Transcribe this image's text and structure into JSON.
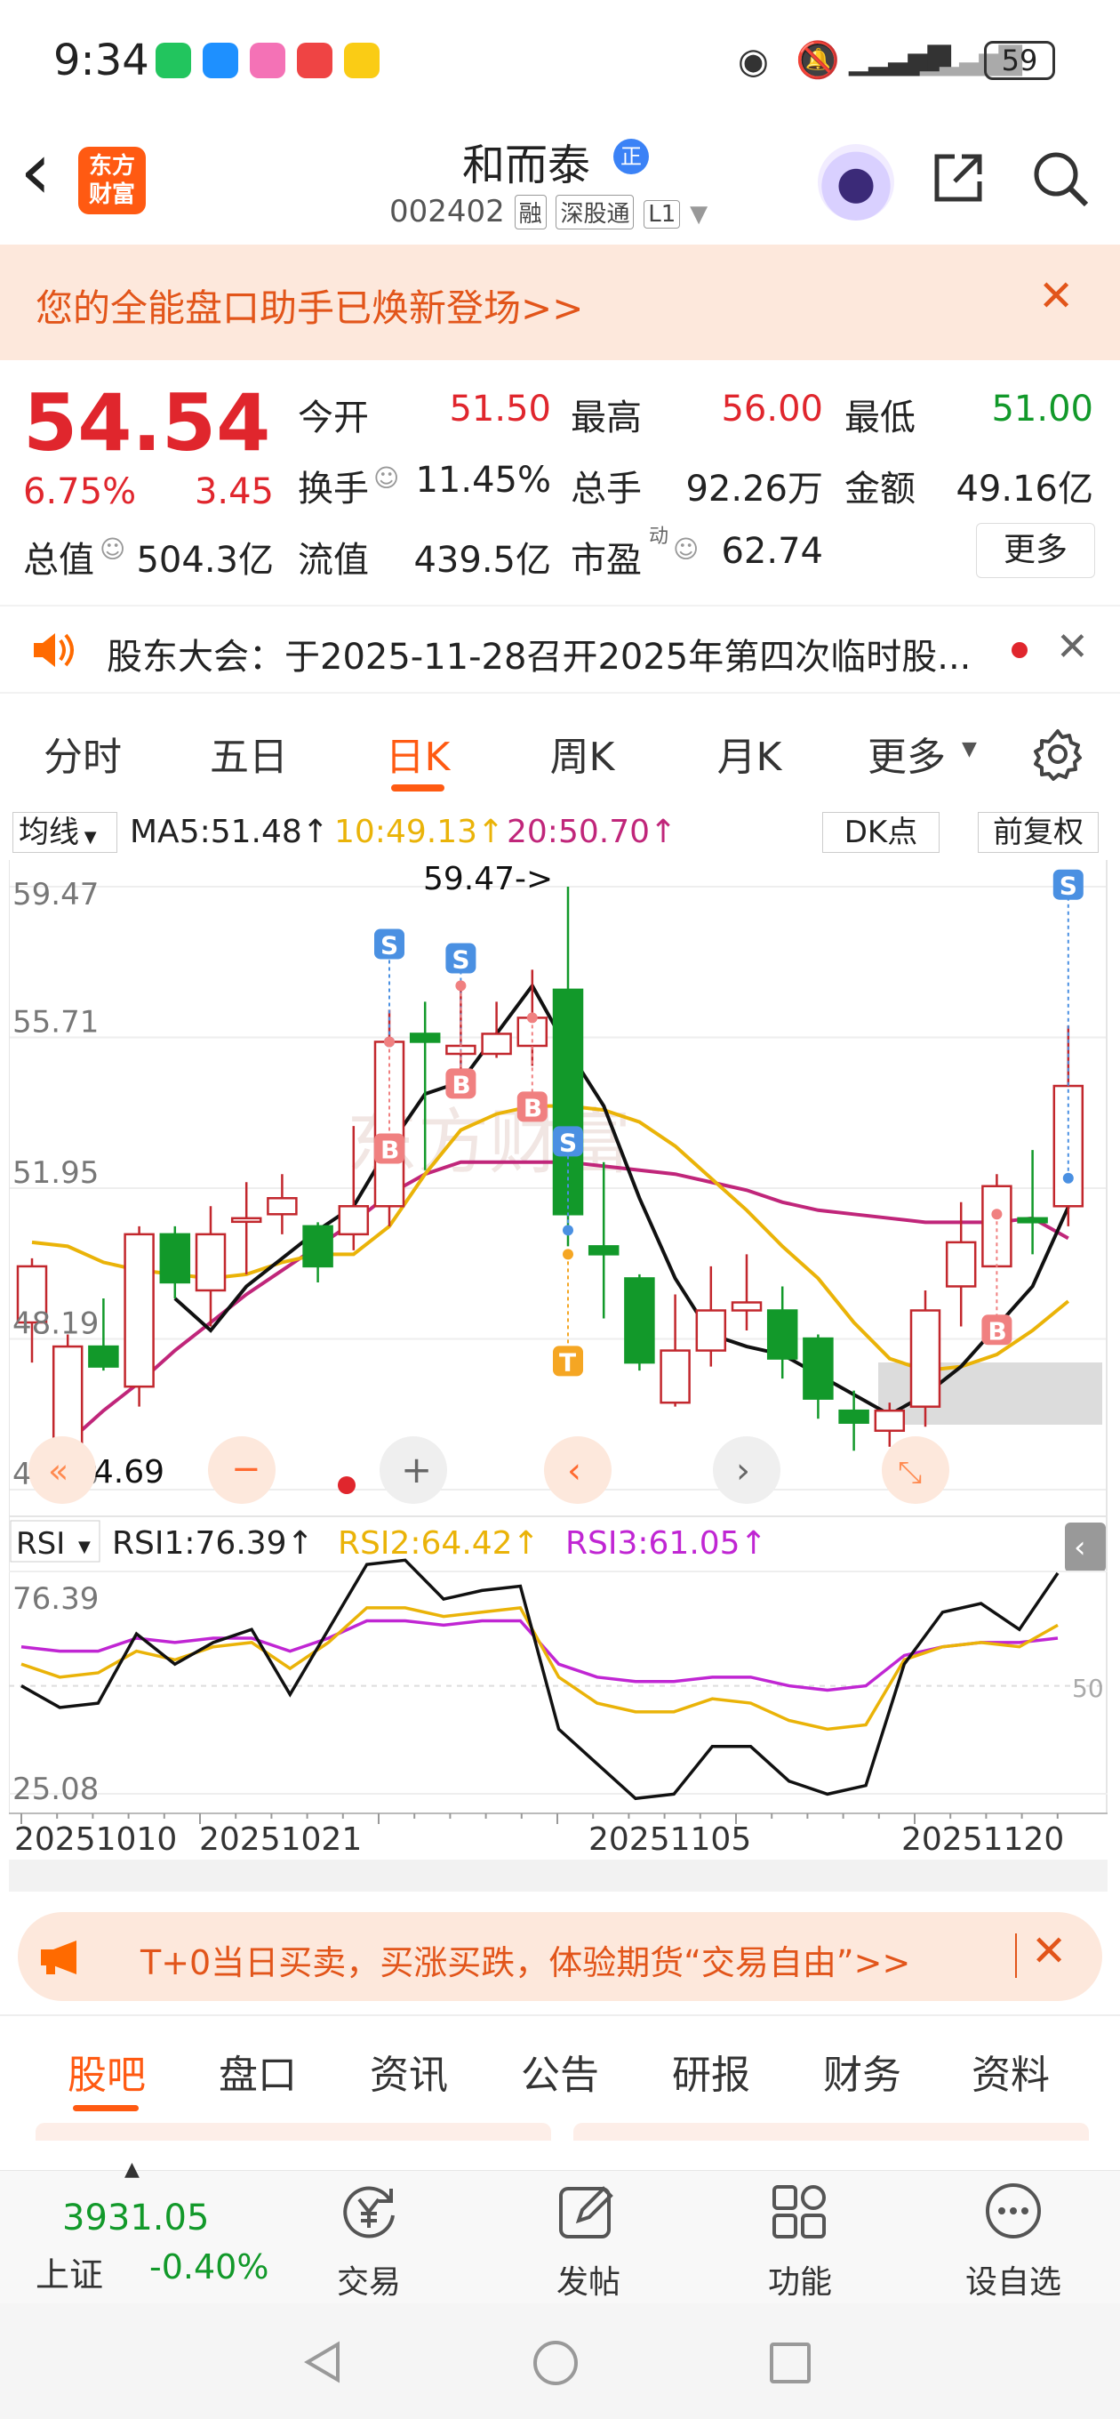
{
  "status": {
    "time": "9:34",
    "battery": "59"
  },
  "header": {
    "back": "‹",
    "logo_line1": "东方",
    "logo_line2": "财富",
    "title": "和而泰",
    "title_badge": "正",
    "code": "002402",
    "tags": [
      "融",
      "深股通",
      "L1"
    ]
  },
  "banner": {
    "text": "您的全能盘口助手已焕新登场>>"
  },
  "quote": {
    "price": "54.54",
    "pct": "6.75%",
    "chg": "3.45",
    "fields": [
      {
        "label": "今开",
        "value": "51.50",
        "color": "red"
      },
      {
        "label": "最高",
        "value": "56.00",
        "color": "red"
      },
      {
        "label": "最低",
        "value": "51.00",
        "color": "green"
      },
      {
        "label": "换手",
        "value": "11.45%",
        "color": "dark"
      },
      {
        "label": "总手",
        "value": "92.26万",
        "color": "dark"
      },
      {
        "label": "金额",
        "value": "49.16亿",
        "color": "dark"
      },
      {
        "label": "总值",
        "value": "504.3亿",
        "color": "dark"
      },
      {
        "label": "流值",
        "value": "439.5亿",
        "color": "dark"
      },
      {
        "label": "市盈",
        "value": "62.74",
        "color": "dark"
      }
    ],
    "dyn_sup": "动",
    "more": "更多"
  },
  "notice": {
    "text": "股东大会：于2025-11-28召开2025年第四次临时股..."
  },
  "tabs": [
    {
      "label": "分时",
      "active": false
    },
    {
      "label": "五日",
      "active": false
    },
    {
      "label": "日K",
      "active": true
    },
    {
      "label": "周K",
      "active": false
    },
    {
      "label": "月K",
      "active": false
    },
    {
      "label": "更多",
      "active": false
    }
  ],
  "ma": {
    "selector": "均线",
    "ma5": "MA5:51.48↑",
    "ma10": "10:49.13↑",
    "ma20": "20:50.70↑",
    "dk": "DK点",
    "fq": "前复权"
  },
  "chart_data": {
    "type": "candlestick",
    "y_ticks": [
      "59.47",
      "55.71",
      "51.95",
      "48.19",
      "44.43"
    ],
    "ylim": [
      44.43,
      59.47
    ],
    "high_label": "59.47->",
    "low_label": "44.69",
    "x_labels": [
      "20251010",
      "20251021",
      "20251105",
      "20251120"
    ],
    "candles": [
      {
        "o": 48.6,
        "c": 50.0,
        "h": 50.2,
        "l": 47.6
      },
      {
        "o": 44.7,
        "c": 48.0,
        "h": 48.3,
        "l": 44.69
      },
      {
        "o": 48.0,
        "c": 47.5,
        "h": 49.2,
        "l": 47.4
      },
      {
        "o": 47.0,
        "c": 50.8,
        "h": 51.0,
        "l": 46.5
      },
      {
        "o": 50.8,
        "c": 49.6,
        "h": 51.0,
        "l": 49.2
      },
      {
        "o": 49.4,
        "c": 50.8,
        "h": 51.5,
        "l": 48.5
      },
      {
        "o": 51.2,
        "c": 51.2,
        "h": 52.1,
        "l": 49.8
      },
      {
        "o": 51.3,
        "c": 51.7,
        "h": 52.3,
        "l": 50.8
      },
      {
        "o": 51.0,
        "c": 50.0,
        "h": 51.1,
        "l": 49.6
      },
      {
        "o": 50.8,
        "c": 51.5,
        "h": 53.5,
        "l": 50.4
      },
      {
        "o": 51.5,
        "c": 55.6,
        "h": 56.4,
        "l": 51.0
      },
      {
        "o": 55.8,
        "c": 55.6,
        "h": 56.6,
        "l": 52.4
      },
      {
        "o": 55.3,
        "c": 55.5,
        "h": 56.9,
        "l": 54.4
      },
      {
        "o": 55.3,
        "c": 55.8,
        "h": 56.6,
        "l": 55.2
      },
      {
        "o": 55.5,
        "c": 56.2,
        "h": 57.4,
        "l": 55.0
      },
      {
        "o": 56.9,
        "c": 51.3,
        "h": 59.47,
        "l": 50.5
      },
      {
        "o": 50.5,
        "c": 50.3,
        "h": 52.6,
        "l": 48.7
      },
      {
        "o": 49.7,
        "c": 47.6,
        "h": 49.8,
        "l": 47.4
      },
      {
        "o": 46.6,
        "c": 47.9,
        "h": 49.3,
        "l": 46.5
      },
      {
        "o": 47.9,
        "c": 48.9,
        "h": 50.0,
        "l": 47.5
      },
      {
        "o": 48.9,
        "c": 49.1,
        "h": 50.3,
        "l": 48.4
      },
      {
        "o": 48.9,
        "c": 47.7,
        "h": 49.5,
        "l": 47.2
      },
      {
        "o": 48.2,
        "c": 46.7,
        "h": 48.3,
        "l": 46.2
      },
      {
        "o": 46.4,
        "c": 46.1,
        "h": 46.9,
        "l": 45.4
      },
      {
        "o": 45.9,
        "c": 46.4,
        "h": 46.6,
        "l": 45.5
      },
      {
        "o": 46.5,
        "c": 48.9,
        "h": 49.4,
        "l": 46.0
      },
      {
        "o": 49.5,
        "c": 50.6,
        "h": 51.6,
        "l": 48.5
      },
      {
        "o": 50.0,
        "c": 52.0,
        "h": 52.3,
        "l": 50.0
      },
      {
        "o": 51.2,
        "c": 51.1,
        "h": 52.9,
        "l": 50.3
      },
      {
        "o": 51.5,
        "c": 54.5,
        "h": 56.0,
        "l": 51.0
      }
    ],
    "ma5": [
      null,
      null,
      null,
      null,
      49.2,
      48.4,
      49.5,
      50.2,
      50.9,
      51.5,
      53.0,
      54.3,
      54.6,
      55.8,
      57.0,
      55.4,
      54.0,
      51.7,
      49.7,
      48.3,
      48.0,
      47.8,
      47.3,
      46.8,
      46.3,
      46.8,
      47.5,
      48.5,
      49.5,
      51.48
    ],
    "ma10": [
      50.6,
      50.5,
      50.1,
      49.9,
      49.8,
      49.7,
      49.8,
      50.1,
      50.3,
      50.3,
      51.0,
      52.3,
      53.4,
      53.8,
      54.0,
      54.0,
      53.9,
      53.6,
      53.0,
      52.2,
      51.4,
      50.5,
      49.7,
      48.6,
      47.7,
      47.4,
      47.5,
      47.8,
      48.4,
      49.13
    ],
    "ma20": [
      44.8,
      45.6,
      46.4,
      47.1,
      47.9,
      48.6,
      49.3,
      49.9,
      50.5,
      51.1,
      51.8,
      52.3,
      52.6,
      52.6,
      52.6,
      52.6,
      52.5,
      52.4,
      52.3,
      52.1,
      51.9,
      51.6,
      51.4,
      51.3,
      51.2,
      51.1,
      51.1,
      51.1,
      51.2,
      50.7
    ],
    "rsi_label": "RSI",
    "rsi1": "RSI1:76.39↑",
    "rsi2": "RSI2:64.42↑",
    "rsi3": "RSI3:61.05↑",
    "rsi_ticks": [
      "76.39",
      "25.08"
    ],
    "rsi_mid": "50",
    "rsi1_values": [
      50,
      45,
      46,
      62,
      55,
      60,
      63,
      48,
      63,
      78,
      79,
      70,
      72,
      73,
      40,
      32,
      24,
      25,
      36,
      36,
      28,
      25,
      27,
      55,
      67,
      69,
      63,
      76
    ],
    "rsi2_values": [
      55,
      52,
      53,
      58,
      56,
      59,
      60,
      54,
      60,
      68,
      68,
      66,
      67,
      68,
      52,
      46,
      44,
      44,
      47,
      46,
      42,
      40,
      41,
      56,
      59,
      60,
      59,
      64
    ],
    "rsi3_values": [
      59,
      58,
      58,
      61,
      60,
      61,
      61,
      58,
      61,
      65,
      65,
      64,
      65,
      65,
      55,
      52,
      51,
      51,
      52,
      52,
      50,
      49,
      50,
      57,
      59,
      60,
      60,
      61
    ]
  },
  "ad": {
    "text": "T+0当日买卖，买涨买跌，体验期货“交易自由”>>"
  },
  "btabs": [
    {
      "label": "股吧",
      "active": true
    },
    {
      "label": "盘口",
      "active": false
    },
    {
      "label": "资讯",
      "active": false
    },
    {
      "label": "公告",
      "active": false
    },
    {
      "label": "研报",
      "active": false
    },
    {
      "label": "财务",
      "active": false
    },
    {
      "label": "资料",
      "active": false
    }
  ],
  "index": {
    "value": "3931.05",
    "name": "上证",
    "pct": "-0.40%"
  },
  "bottom": [
    {
      "label": "交易",
      "icon": "yen-icon"
    },
    {
      "label": "发帖",
      "icon": "edit-icon"
    },
    {
      "label": "功能",
      "icon": "grid-icon"
    },
    {
      "label": "设自选",
      "icon": "dots-icon"
    }
  ]
}
